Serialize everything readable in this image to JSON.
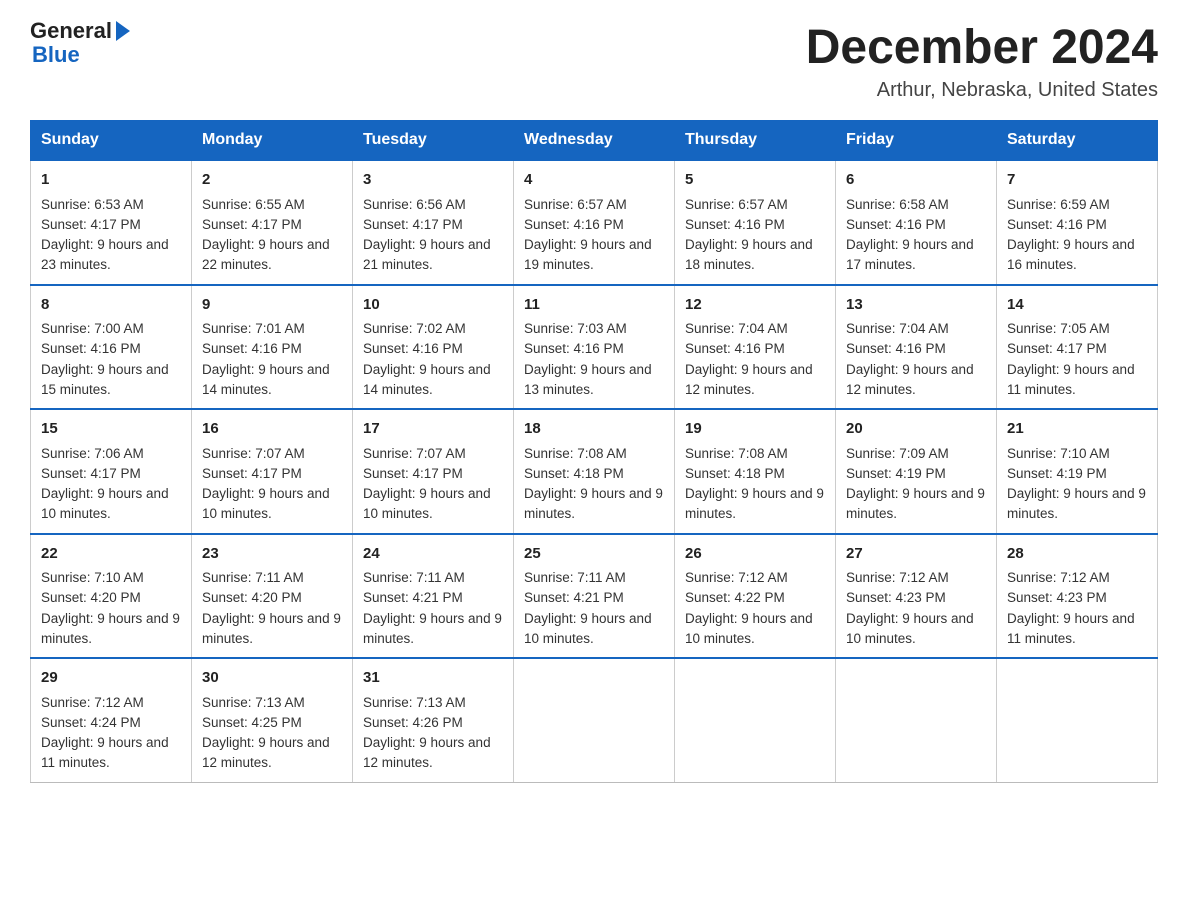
{
  "header": {
    "logo_general": "General",
    "logo_blue": "Blue",
    "month_title": "December 2024",
    "location": "Arthur, Nebraska, United States"
  },
  "days_of_week": [
    "Sunday",
    "Monday",
    "Tuesday",
    "Wednesday",
    "Thursday",
    "Friday",
    "Saturday"
  ],
  "weeks": [
    [
      {
        "day": "1",
        "sunrise": "Sunrise: 6:53 AM",
        "sunset": "Sunset: 4:17 PM",
        "daylight": "Daylight: 9 hours and 23 minutes."
      },
      {
        "day": "2",
        "sunrise": "Sunrise: 6:55 AM",
        "sunset": "Sunset: 4:17 PM",
        "daylight": "Daylight: 9 hours and 22 minutes."
      },
      {
        "day": "3",
        "sunrise": "Sunrise: 6:56 AM",
        "sunset": "Sunset: 4:17 PM",
        "daylight": "Daylight: 9 hours and 21 minutes."
      },
      {
        "day": "4",
        "sunrise": "Sunrise: 6:57 AM",
        "sunset": "Sunset: 4:16 PM",
        "daylight": "Daylight: 9 hours and 19 minutes."
      },
      {
        "day": "5",
        "sunrise": "Sunrise: 6:57 AM",
        "sunset": "Sunset: 4:16 PM",
        "daylight": "Daylight: 9 hours and 18 minutes."
      },
      {
        "day": "6",
        "sunrise": "Sunrise: 6:58 AM",
        "sunset": "Sunset: 4:16 PM",
        "daylight": "Daylight: 9 hours and 17 minutes."
      },
      {
        "day": "7",
        "sunrise": "Sunrise: 6:59 AM",
        "sunset": "Sunset: 4:16 PM",
        "daylight": "Daylight: 9 hours and 16 minutes."
      }
    ],
    [
      {
        "day": "8",
        "sunrise": "Sunrise: 7:00 AM",
        "sunset": "Sunset: 4:16 PM",
        "daylight": "Daylight: 9 hours and 15 minutes."
      },
      {
        "day": "9",
        "sunrise": "Sunrise: 7:01 AM",
        "sunset": "Sunset: 4:16 PM",
        "daylight": "Daylight: 9 hours and 14 minutes."
      },
      {
        "day": "10",
        "sunrise": "Sunrise: 7:02 AM",
        "sunset": "Sunset: 4:16 PM",
        "daylight": "Daylight: 9 hours and 14 minutes."
      },
      {
        "day": "11",
        "sunrise": "Sunrise: 7:03 AM",
        "sunset": "Sunset: 4:16 PM",
        "daylight": "Daylight: 9 hours and 13 minutes."
      },
      {
        "day": "12",
        "sunrise": "Sunrise: 7:04 AM",
        "sunset": "Sunset: 4:16 PM",
        "daylight": "Daylight: 9 hours and 12 minutes."
      },
      {
        "day": "13",
        "sunrise": "Sunrise: 7:04 AM",
        "sunset": "Sunset: 4:16 PM",
        "daylight": "Daylight: 9 hours and 12 minutes."
      },
      {
        "day": "14",
        "sunrise": "Sunrise: 7:05 AM",
        "sunset": "Sunset: 4:17 PM",
        "daylight": "Daylight: 9 hours and 11 minutes."
      }
    ],
    [
      {
        "day": "15",
        "sunrise": "Sunrise: 7:06 AM",
        "sunset": "Sunset: 4:17 PM",
        "daylight": "Daylight: 9 hours and 10 minutes."
      },
      {
        "day": "16",
        "sunrise": "Sunrise: 7:07 AM",
        "sunset": "Sunset: 4:17 PM",
        "daylight": "Daylight: 9 hours and 10 minutes."
      },
      {
        "day": "17",
        "sunrise": "Sunrise: 7:07 AM",
        "sunset": "Sunset: 4:17 PM",
        "daylight": "Daylight: 9 hours and 10 minutes."
      },
      {
        "day": "18",
        "sunrise": "Sunrise: 7:08 AM",
        "sunset": "Sunset: 4:18 PM",
        "daylight": "Daylight: 9 hours and 9 minutes."
      },
      {
        "day": "19",
        "sunrise": "Sunrise: 7:08 AM",
        "sunset": "Sunset: 4:18 PM",
        "daylight": "Daylight: 9 hours and 9 minutes."
      },
      {
        "day": "20",
        "sunrise": "Sunrise: 7:09 AM",
        "sunset": "Sunset: 4:19 PM",
        "daylight": "Daylight: 9 hours and 9 minutes."
      },
      {
        "day": "21",
        "sunrise": "Sunrise: 7:10 AM",
        "sunset": "Sunset: 4:19 PM",
        "daylight": "Daylight: 9 hours and 9 minutes."
      }
    ],
    [
      {
        "day": "22",
        "sunrise": "Sunrise: 7:10 AM",
        "sunset": "Sunset: 4:20 PM",
        "daylight": "Daylight: 9 hours and 9 minutes."
      },
      {
        "day": "23",
        "sunrise": "Sunrise: 7:11 AM",
        "sunset": "Sunset: 4:20 PM",
        "daylight": "Daylight: 9 hours and 9 minutes."
      },
      {
        "day": "24",
        "sunrise": "Sunrise: 7:11 AM",
        "sunset": "Sunset: 4:21 PM",
        "daylight": "Daylight: 9 hours and 9 minutes."
      },
      {
        "day": "25",
        "sunrise": "Sunrise: 7:11 AM",
        "sunset": "Sunset: 4:21 PM",
        "daylight": "Daylight: 9 hours and 10 minutes."
      },
      {
        "day": "26",
        "sunrise": "Sunrise: 7:12 AM",
        "sunset": "Sunset: 4:22 PM",
        "daylight": "Daylight: 9 hours and 10 minutes."
      },
      {
        "day": "27",
        "sunrise": "Sunrise: 7:12 AM",
        "sunset": "Sunset: 4:23 PM",
        "daylight": "Daylight: 9 hours and 10 minutes."
      },
      {
        "day": "28",
        "sunrise": "Sunrise: 7:12 AM",
        "sunset": "Sunset: 4:23 PM",
        "daylight": "Daylight: 9 hours and 11 minutes."
      }
    ],
    [
      {
        "day": "29",
        "sunrise": "Sunrise: 7:12 AM",
        "sunset": "Sunset: 4:24 PM",
        "daylight": "Daylight: 9 hours and 11 minutes."
      },
      {
        "day": "30",
        "sunrise": "Sunrise: 7:13 AM",
        "sunset": "Sunset: 4:25 PM",
        "daylight": "Daylight: 9 hours and 12 minutes."
      },
      {
        "day": "31",
        "sunrise": "Sunrise: 7:13 AM",
        "sunset": "Sunset: 4:26 PM",
        "daylight": "Daylight: 9 hours and 12 minutes."
      },
      null,
      null,
      null,
      null
    ]
  ]
}
